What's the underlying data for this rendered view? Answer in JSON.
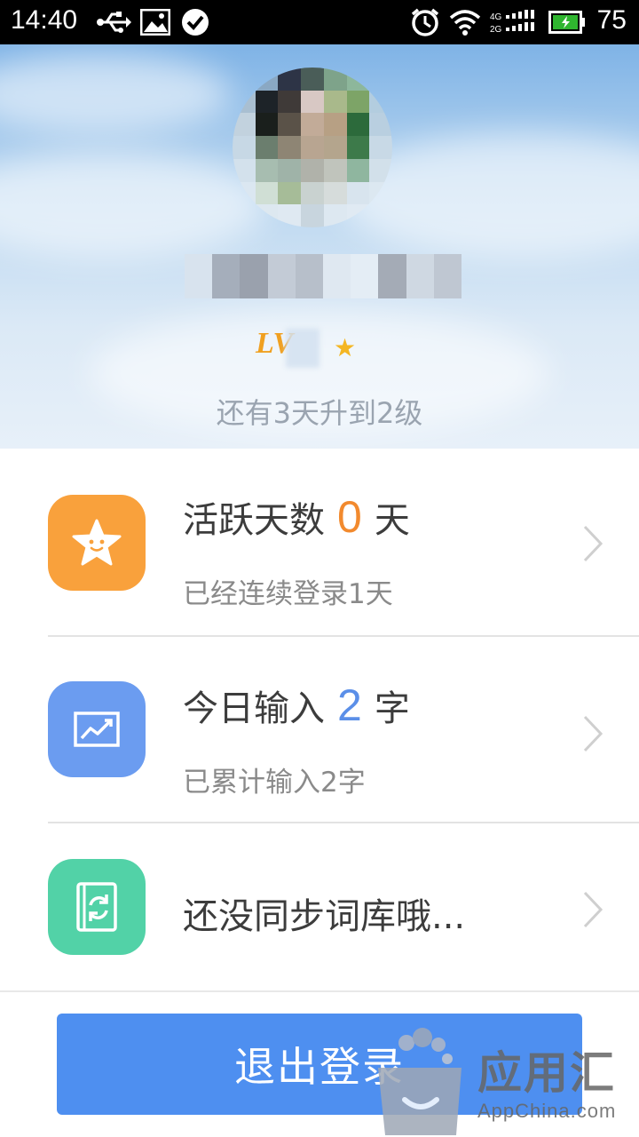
{
  "status_bar": {
    "time": "14:40",
    "battery_level": "75",
    "icons": [
      "usb-icon",
      "image-icon",
      "check-circle-icon",
      "alarm-icon",
      "wifi-icon",
      "signal-4g-2g-icon",
      "battery-icon"
    ]
  },
  "profile": {
    "level_label": "LV",
    "level_hint": "还有3天升到2级"
  },
  "stats": [
    {
      "icon": "star-icon",
      "color": "#f9a13c",
      "title_prefix": "活跃天数",
      "number": "0",
      "number_color": "#f28a2e",
      "title_suffix": "天",
      "subtitle": "已经连续登录1天"
    },
    {
      "icon": "trend-chart-icon",
      "color": "#6b9cf0",
      "title_prefix": "今日输入",
      "number": "2",
      "number_color": "#5b8fe8",
      "title_suffix": "字",
      "subtitle": "已累计输入2字"
    },
    {
      "icon": "sync-book-icon",
      "color": "#52d2a7",
      "title": "还没同步词库哦..."
    }
  ],
  "logout_label": "退出登录",
  "watermark": {
    "title": "应用汇",
    "domain": "AppChina.com"
  }
}
